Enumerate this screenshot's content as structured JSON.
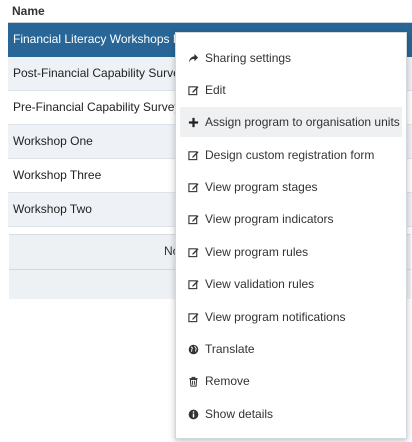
{
  "table": {
    "header": "Name",
    "rows": [
      "Financial Literacy Workshops Pro",
      "Post-Financial Capability Survey",
      "Pre-Financial Capability Survey",
      "Workshop One",
      "Workshop Three",
      "Workshop Two"
    ],
    "footer_text": "No"
  },
  "menu": {
    "items": [
      {
        "label": "Sharing settings",
        "icon": "share-icon"
      },
      {
        "label": "Edit",
        "icon": "edit-icon"
      },
      {
        "label": "Assign program to organisation units",
        "icon": "plus-icon"
      },
      {
        "label": "Design custom registration form",
        "icon": "edit-icon"
      },
      {
        "label": "View program stages",
        "icon": "edit-icon"
      },
      {
        "label": "View program indicators",
        "icon": "edit-icon"
      },
      {
        "label": "View program rules",
        "icon": "edit-icon"
      },
      {
        "label": "View validation rules",
        "icon": "edit-icon"
      },
      {
        "label": "View program notifications",
        "icon": "edit-icon"
      },
      {
        "label": "Translate",
        "icon": "globe-icon"
      },
      {
        "label": "Remove",
        "icon": "trash-icon"
      },
      {
        "label": "Show details",
        "icon": "info-icon"
      }
    ]
  },
  "colors": {
    "selected_row": "#276696",
    "alt_row": "#eef2f6"
  }
}
